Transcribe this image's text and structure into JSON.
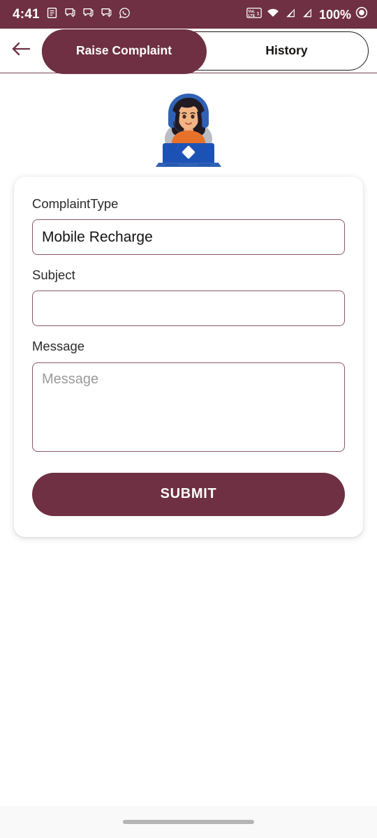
{
  "theme": {
    "primary": "#6E3042",
    "border": "#8A5868",
    "text": "#131313",
    "placeholder": "#9a9a9a",
    "card_bg": "#ffffff",
    "page_bg": "#ffffff",
    "nav_bg": "#f9f9f9"
  },
  "status_bar": {
    "time": "4:41",
    "battery_text": "100%",
    "left_icons": [
      "document-notification-icon",
      "message-bubble-icon",
      "message-bubble-icon",
      "message-bubble-icon",
      "whatsapp-icon"
    ],
    "right_icons": [
      "volte-icon",
      "wifi-icon",
      "signal-bars-icon",
      "signal-bars-icon",
      "battery-icon"
    ]
  },
  "header": {
    "back_icon": "back-arrow-icon",
    "tabs": [
      {
        "label": "Raise Complaint",
        "selected": true
      },
      {
        "label": "History",
        "selected": false
      }
    ]
  },
  "hero": {
    "illustration": "customer-support-agent-illustration"
  },
  "form": {
    "complaint_type": {
      "label": "ComplaintType",
      "value": "Mobile Recharge"
    },
    "subject": {
      "label": "Subject",
      "value": "",
      "placeholder": ""
    },
    "message": {
      "label": "Message",
      "value": "",
      "placeholder": "Message"
    },
    "submit_label": "SUBMIT"
  },
  "navigation_bar": {
    "home_indicator": "home-gesture-pill"
  }
}
